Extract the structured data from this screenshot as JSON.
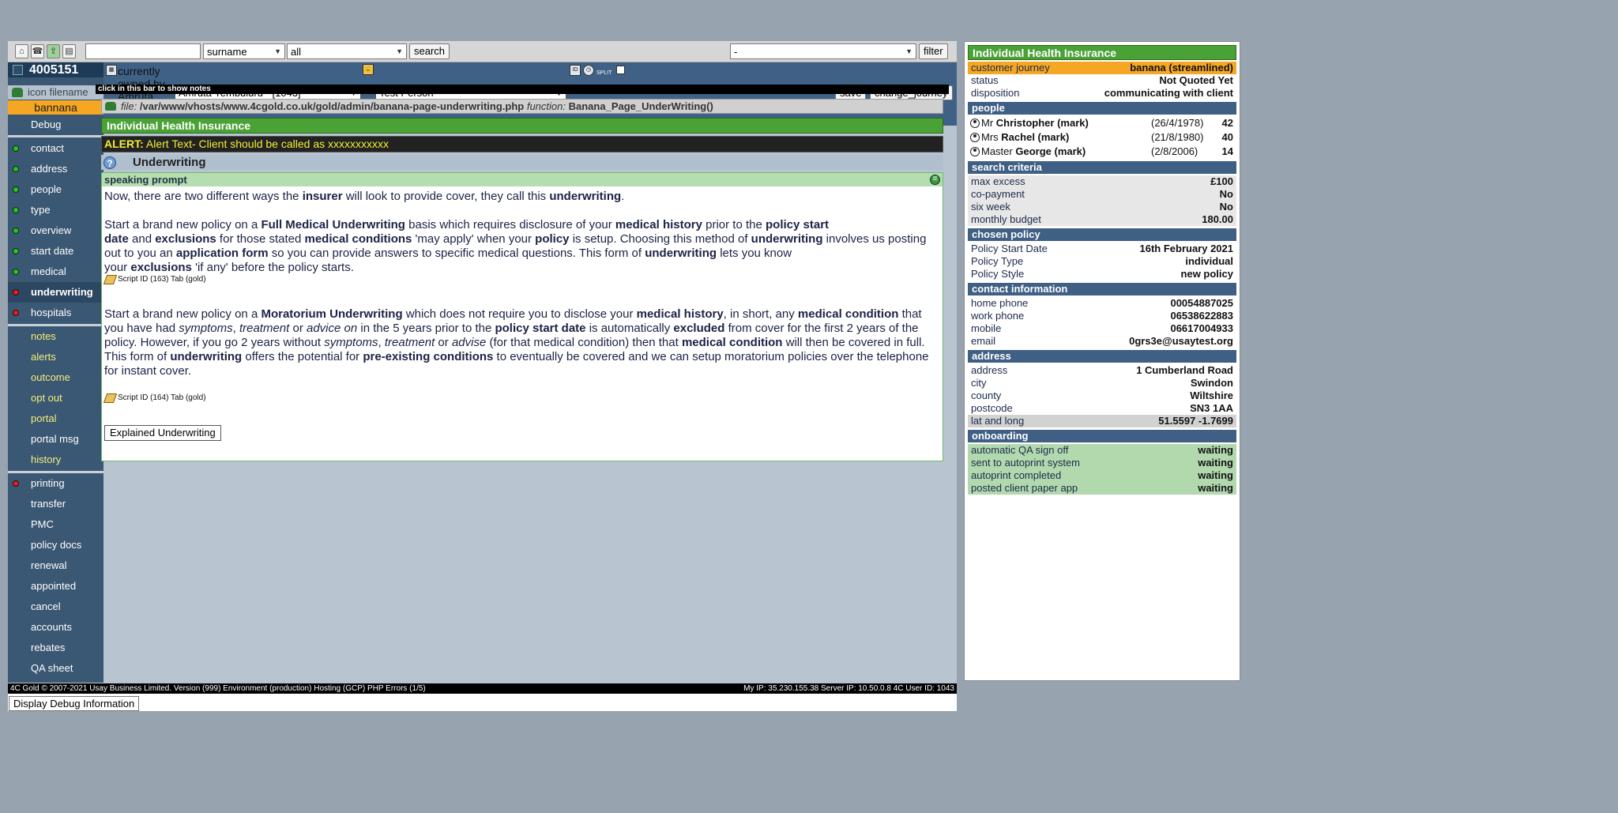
{
  "toolbar": {
    "search_value": "",
    "field_select": "surname",
    "scope_select": "all",
    "search_label": "search",
    "filter_select": "-",
    "filter_label": "filter"
  },
  "sidebar": {
    "client_id": "4005151",
    "icon_filename": "icon filename",
    "bannana": "bannana",
    "debug": "Debug",
    "items": [
      {
        "label": "contact",
        "dot": "green"
      },
      {
        "label": "address",
        "dot": "green"
      },
      {
        "label": "people",
        "dot": "green"
      },
      {
        "label": "type",
        "dot": "green"
      },
      {
        "label": "overview",
        "dot": "green"
      },
      {
        "label": "start date",
        "dot": "green"
      },
      {
        "label": "medical",
        "dot": "green"
      },
      {
        "label": "underwriting",
        "dot": "red"
      },
      {
        "label": "hospitals",
        "dot": "red"
      }
    ],
    "yellow_items": [
      "notes",
      "alerts",
      "outcome",
      "opt out",
      "portal",
      "portal msg",
      "history"
    ],
    "lower_items": [
      {
        "label": "printing",
        "dot": "red"
      },
      {
        "label": "transfer"
      },
      {
        "label": "PMC"
      },
      {
        "label": "policy docs"
      },
      {
        "label": "renewal"
      },
      {
        "label": "appointed"
      },
      {
        "label": "cancel"
      },
      {
        "label": "accounts"
      },
      {
        "label": "rebates"
      },
      {
        "label": "QA sheet"
      }
    ]
  },
  "header": {
    "owned_by_text": "currently owned by Amruta Yembuluru",
    "owner_select": "Amruta Yembuluru - [1043]",
    "person_select": "Test Person",
    "save_label": "save",
    "change_journey_label": "change_journey",
    "split_label": "SPLIT",
    "notes_bar": "click in this bar to show notes"
  },
  "content": {
    "file_label": "file:",
    "file_path": "/var/www/vhosts/www.4cgold.co.uk/gold/admin/banana-page-underwriting.php",
    "function_label": "function:",
    "function_name": "Banana_Page_UnderWriting()",
    "section_title": "Individual Health Insurance",
    "alert_label": "ALERT:",
    "alert_text": "Alert Text- Client should be called as xxxxxxxxxxx",
    "page_title": "Underwriting",
    "prompt_title": "speaking prompt",
    "script_id_1": "Script ID (163) Tab (gold)",
    "script_id_2": "Script ID (164) Tab (gold)",
    "explained_button": "Explained Underwriting"
  },
  "footer": {
    "left": "4C Gold © 2007-2021 Usay Business Limited. Version (999) Environment (production) Hosting (GCP) PHP Errors (1/5)",
    "right": "My IP: 35.230.155.38 Server IP: 10.50.0.8 4C User ID: 1043",
    "debug_button": "Display Debug Information"
  },
  "summary": {
    "title": "Individual Health Insurance",
    "journey": {
      "k": "customer journey",
      "v": "banana (streamlined)"
    },
    "status": {
      "k": "status",
      "v": "Not Quoted Yet"
    },
    "disposition": {
      "k": "disposition",
      "v": "communicating with client"
    },
    "people_head": "people",
    "people": [
      {
        "title": "Mr",
        "name": "Christopher (mark)",
        "dob": "(26/4/1978)",
        "age": "42"
      },
      {
        "title": "Mrs",
        "name": "Rachel (mark)",
        "dob": "(21/8/1980)",
        "age": "40"
      },
      {
        "title": "Master",
        "name": "George (mark)",
        "dob": "(2/8/2006)",
        "age": "14"
      }
    ],
    "search_head": "search criteria",
    "search": [
      {
        "k": "max excess",
        "v": "£100"
      },
      {
        "k": "co-payment",
        "v": "No"
      },
      {
        "k": "six week",
        "v": "No"
      },
      {
        "k": "monthly budget",
        "v": "180.00"
      }
    ],
    "policy_head": "chosen policy",
    "policy": [
      {
        "k": "Policy Start Date",
        "v": "16th February 2021"
      },
      {
        "k": "Policy Type",
        "v": "individual"
      },
      {
        "k": "Policy Style",
        "v": "new policy"
      }
    ],
    "contact_head": "contact information",
    "contact": [
      {
        "k": "home phone",
        "v": "00054887025"
      },
      {
        "k": "work phone",
        "v": "06538622883"
      },
      {
        "k": "mobile",
        "v": "06617004933"
      },
      {
        "k": "email",
        "v": "0grs3e@usaytest.org"
      }
    ],
    "address_head": "address",
    "address": [
      {
        "k": "address",
        "v": "1 Cumberland Road"
      },
      {
        "k": "city",
        "v": "Swindon"
      },
      {
        "k": "county",
        "v": "Wiltshire"
      },
      {
        "k": "postcode",
        "v": "SN3 1AA"
      },
      {
        "k": "lat and long",
        "v": "51.5597 -1.7699"
      }
    ],
    "onboarding_head": "onboarding",
    "onboarding": [
      {
        "k": "automatic QA sign off",
        "v": "waiting"
      },
      {
        "k": "sent to autoprint system",
        "v": "waiting"
      },
      {
        "k": "autoprint completed",
        "v": "waiting"
      },
      {
        "k": "posted client paper app",
        "v": "waiting"
      }
    ]
  }
}
